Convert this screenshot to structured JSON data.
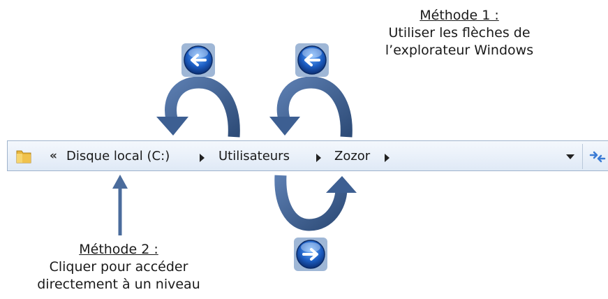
{
  "addressbar": {
    "chevron": "«",
    "crumbs": [
      "Disque local (C:)",
      "Utilisateurs",
      "Zozor"
    ],
    "dropdown_icon": "chevron-down-icon",
    "refresh_icon": "refresh-icon",
    "folder_icon": "folder-icon"
  },
  "method1": {
    "title": "Méthode 1 :",
    "lines": [
      "Utiliser les flèches de",
      "l’explorateur  Windows"
    ]
  },
  "method2": {
    "title": "Méthode 2 :",
    "lines": [
      "Cliquer pour accéder",
      "directement à un niveau"
    ]
  },
  "colors": {
    "arrow": "#4b6c9c",
    "arrow_dark": "#2e4c78",
    "orb_blue": "#1f5fb8",
    "bar_border": "#9fb3cc"
  }
}
